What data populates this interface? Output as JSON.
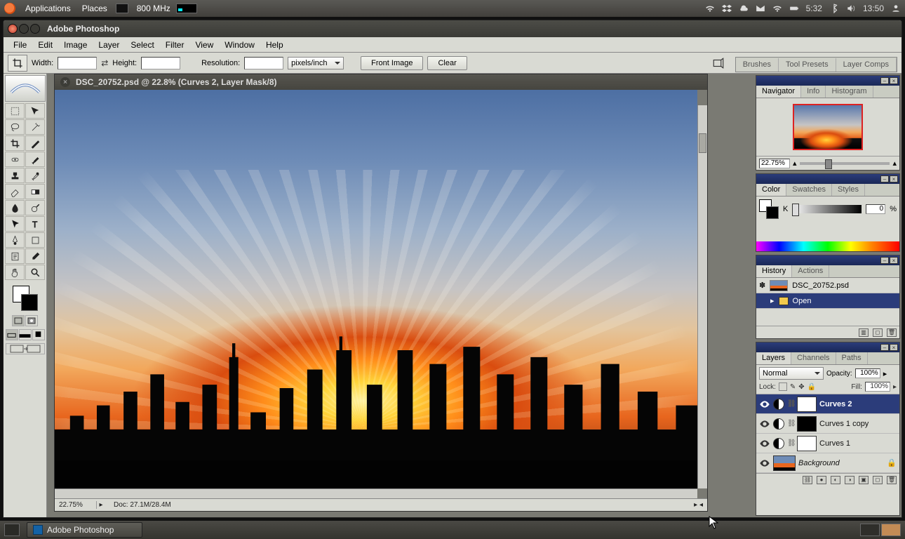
{
  "os": {
    "applications": "Applications",
    "places": "Places",
    "cpu": "800 MHz",
    "battery_time": "5:32",
    "clock": "13:50"
  },
  "window": {
    "title": "Adobe Photoshop"
  },
  "menu": {
    "file": "File",
    "edit": "Edit",
    "image": "Image",
    "layer": "Layer",
    "select": "Select",
    "filter": "Filter",
    "view": "View",
    "window": "Window",
    "help": "Help"
  },
  "options": {
    "width_label": "Width:",
    "height_label": "Height:",
    "resolution_label": "Resolution:",
    "unit": "pixels/inch",
    "front_image": "Front Image",
    "clear": "Clear",
    "tabs": {
      "brushes": "Brushes",
      "presets": "Tool Presets",
      "comps": "Layer Comps"
    }
  },
  "doc": {
    "title": "DSC_20752.psd @ 22.8% (Curves 2, Layer Mask/8)",
    "zoom": "22.75%",
    "info": "Doc: 27.1M/28.4M"
  },
  "navigator": {
    "tab": "Navigator",
    "info": "Info",
    "hist": "Histogram",
    "zoom": "22.75%"
  },
  "color": {
    "tab": "Color",
    "swatches": "Swatches",
    "styles": "Styles",
    "channel": "K",
    "value": "0",
    "pct": "%"
  },
  "history": {
    "tab": "History",
    "actions": "Actions",
    "file": "DSC_20752.psd",
    "step": "Open"
  },
  "layers": {
    "tab": "Layers",
    "channels": "Channels",
    "paths": "Paths",
    "blend": "Normal",
    "opacity_label": "Opacity:",
    "opacity": "100%",
    "lock_label": "Lock:",
    "fill_label": "Fill:",
    "fill": "100%",
    "rows": {
      "curves2": "Curves 2",
      "curves1copy": "Curves 1 copy",
      "curves1": "Curves 1",
      "background": "Background"
    }
  },
  "taskbar": {
    "app": "Adobe Photoshop"
  }
}
